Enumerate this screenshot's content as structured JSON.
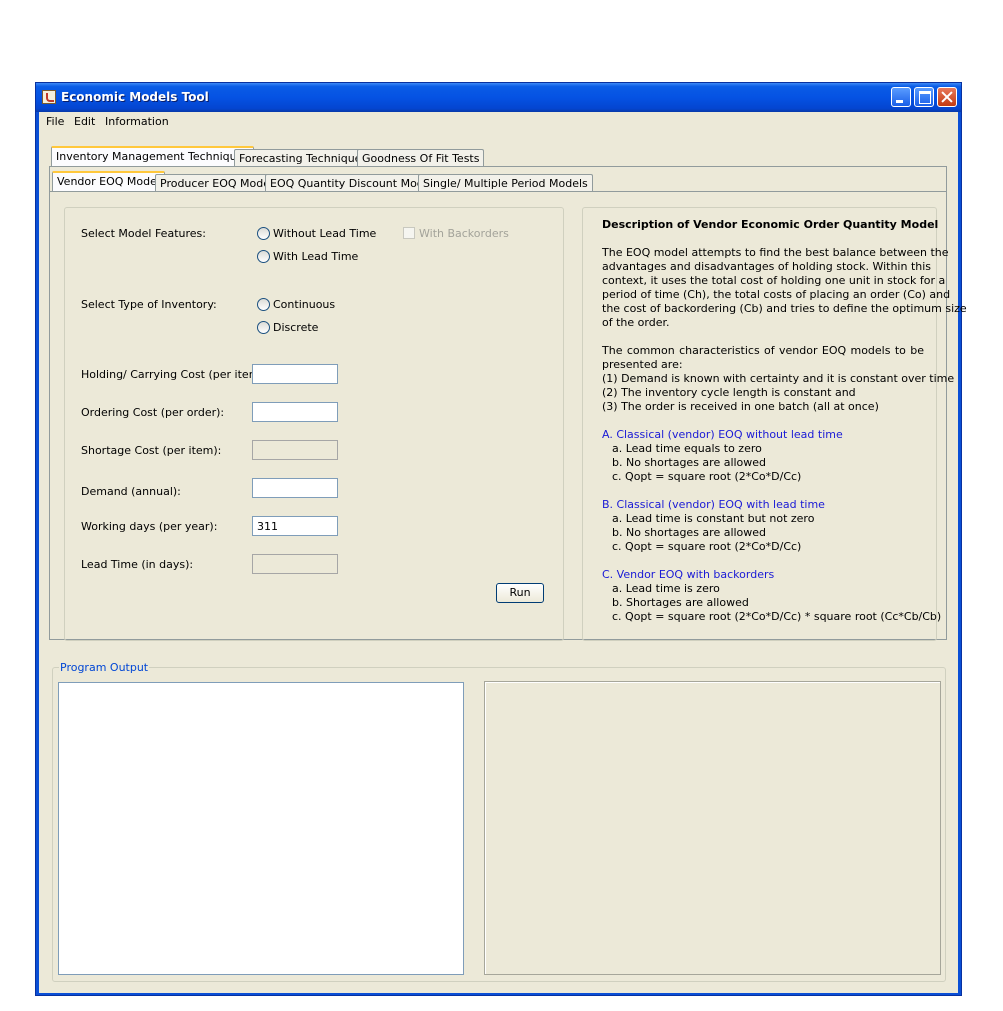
{
  "window": {
    "title": "Economic Models Tool"
  },
  "menu": [
    "File",
    "Edit",
    "Information"
  ],
  "main_tabs": [
    "Inventory Management Techniques",
    "Forecasting Techniques",
    "Goodness Of Fit Tests"
  ],
  "sub_tabs": [
    "Vendor EOQ Model",
    "Producer EOQ Model",
    "EOQ Quantity Discount Model",
    "Single/ Multiple Period Models"
  ],
  "form": {
    "model_features_label": "Select Model Features:",
    "without_lead_time": "Without Lead Time",
    "with_backorders": "With Backorders",
    "with_lead_time": "With Lead Time",
    "inventory_type_label": "Select Type of Inventory:",
    "continuous": "Continuous",
    "discrete": "Discrete",
    "holding_cost_label": "Holding/ Carrying Cost (per item):",
    "ordering_cost_label": "Ordering Cost (per order):",
    "shortage_cost_label": "Shortage Cost (per item):",
    "demand_label": "Demand (annual):",
    "working_days_label": "Working days (per year):",
    "working_days_value": "311",
    "lead_time_label": "Lead Time (in days):",
    "run": "Run"
  },
  "description": {
    "title": "Description of Vendor Economic Order Quantity Model",
    "p1": [
      "The EOQ model attempts to find the best balance between the",
      "advantages and disadvantages of holding stock. Within this",
      "context, it uses the total cost of holding one unit in stock for a",
      "period of time (Ch), the total costs of placing an order (Co) and",
      "the cost of backordering (Cb) and tries to define the optimum size"
    ],
    "p1_last": "of the order.",
    "p2_first": "The common characteristics of vendor EOQ models to be",
    "p2": [
      "presented are:",
      "(1) Demand is known with certainty and it is constant over time",
      "(2) The inventory cycle length is constant and",
      "(3) The order is received in one batch (all at once)"
    ],
    "sections": [
      {
        "heading": "A.   Classical (vendor) EOQ without lead time",
        "items": [
          "a. Lead time equals to zero",
          "b. No shortages are allowed",
          "c. Qopt = square root (2*Co*D/Cc)"
        ]
      },
      {
        "heading": "B.   Classical (vendor) EOQ with lead time",
        "items": [
          "a. Lead time is constant but not zero",
          "b. No shortages are allowed",
          "c. Qopt = square root (2*Co*D/Cc)"
        ]
      },
      {
        "heading": "C.   Vendor EOQ with backorders",
        "items": [
          "a. Lead time is zero",
          "b. Shortages are allowed",
          "c. Qopt = square root (2*Co*D/Cc) * square root (Cc*Cb/Cb)"
        ]
      }
    ]
  },
  "output": {
    "label": "Program Output"
  }
}
